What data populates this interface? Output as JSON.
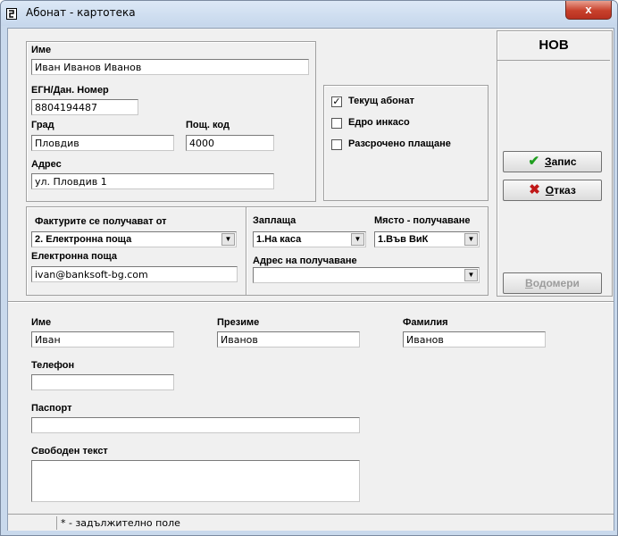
{
  "window": {
    "title": "Абонат - картотека",
    "close_symbol": "x"
  },
  "form": {
    "name_label": "Име",
    "name_value": "Иван Иванов Иванов",
    "egn_label": "ЕГН/Дан. Номер",
    "egn_value": "8804194487",
    "city_label": "Град",
    "city_value": "Пловдив",
    "zip_label": "Пощ. код",
    "zip_value": "4000",
    "address_label": "Адрес",
    "address_value": "ул. Пловдив 1"
  },
  "options": {
    "current_subscriber": {
      "label": "Текущ абонат",
      "checked": true
    },
    "bulk_collection": {
      "label": "Едро инкасо",
      "checked": false
    },
    "installment_payment": {
      "label": "Разсрочено плащане",
      "checked": false
    }
  },
  "delivery": {
    "invoices_label": "Фактурите се получават от",
    "invoices_value": "2. Електронна поща",
    "email_label": "Електронна поща",
    "email_value": "ivan@banksoft-bg.com"
  },
  "payment": {
    "pays_label": "Заплаща",
    "pays_value": "1.На каса",
    "place_label": "Място - получаване",
    "place_value": "1.Във ВиК",
    "receipt_address_label": "Адрес на получаване",
    "receipt_address_value": ""
  },
  "side": {
    "status": "НОВ",
    "save_label_u": "З",
    "save_label_rest": "апис",
    "cancel_label_u": "О",
    "cancel_label_rest": "тказ",
    "meters_label_u": "В",
    "meters_label_rest": "одомери"
  },
  "person": {
    "first_name_label": "Име",
    "first_name_value": "Иван",
    "middle_name_label": "Презиме",
    "middle_name_value": "Иванов",
    "last_name_label": "Фамилия",
    "last_name_value": "Иванов",
    "phone_label": "Телефон",
    "phone_value": "",
    "passport_label": "Паспорт",
    "passport_value": "",
    "free_text_label": "Свободен текст",
    "free_text_value": ""
  },
  "status_bar": {
    "note": "* - задължително поле"
  },
  "colors": {
    "save_check": "#1f9e1f",
    "cancel_x": "#c01818"
  }
}
